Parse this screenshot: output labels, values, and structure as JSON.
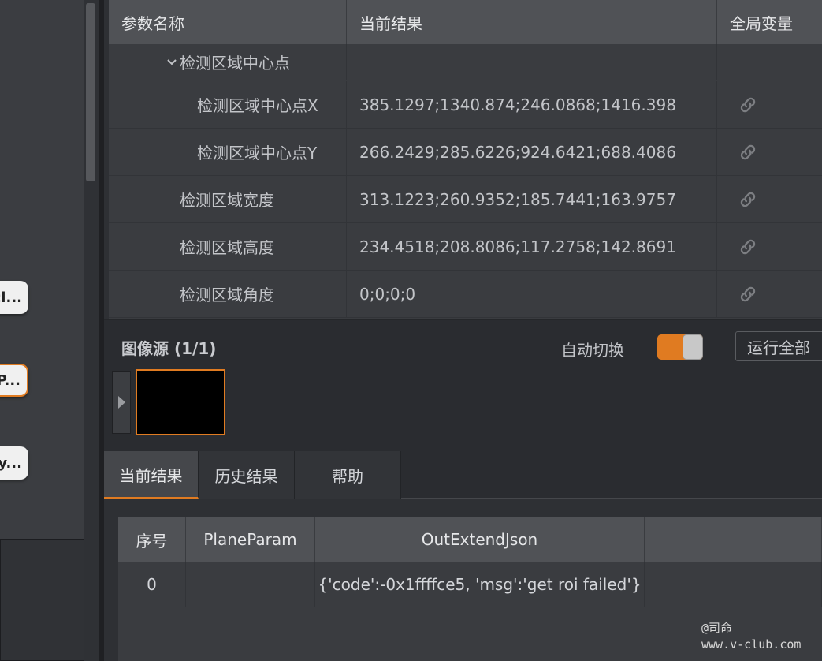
{
  "left_nodes": [
    "cl...",
    "hP...",
    "y..."
  ],
  "param_table": {
    "headers": [
      "参数名称",
      "当前结果",
      "全局变量"
    ],
    "group": "检测区域中心点",
    "rows": [
      {
        "name": "检测区域中心点X",
        "value": "385.1297;1340.874;246.0868;1416.398"
      },
      {
        "name": "检测区域中心点Y",
        "value": "266.2429;285.6226;924.6421;688.4086"
      },
      {
        "name": "检测区域宽度",
        "value": "313.1223;260.9352;185.7441;163.9757"
      },
      {
        "name": "检测区域高度",
        "value": "234.4518;208.8086;117.2758;142.8691"
      },
      {
        "name": "检测区域角度",
        "value": "0;0;0;0"
      }
    ]
  },
  "image_source": {
    "title": "图像源 (1/1)",
    "auto_switch_label": "自动切换",
    "auto_switch_on": true,
    "run_all_label": "运行全部"
  },
  "tabs": [
    "当前结果",
    "历史结果",
    "帮助"
  ],
  "result_table": {
    "headers": [
      "序号",
      "PlaneParam",
      "OutExtendJson",
      ""
    ],
    "rows": [
      [
        "0",
        "",
        "{'code':-0x1ffffce5, 'msg':'get roi failed'}",
        ""
      ]
    ]
  },
  "watermark": {
    "line1": "@司命",
    "line2": "www.v-club.com"
  },
  "colors": {
    "accent": "#e07b21",
    "header_bg": "#505256",
    "row_bg": "#3a3c40"
  }
}
